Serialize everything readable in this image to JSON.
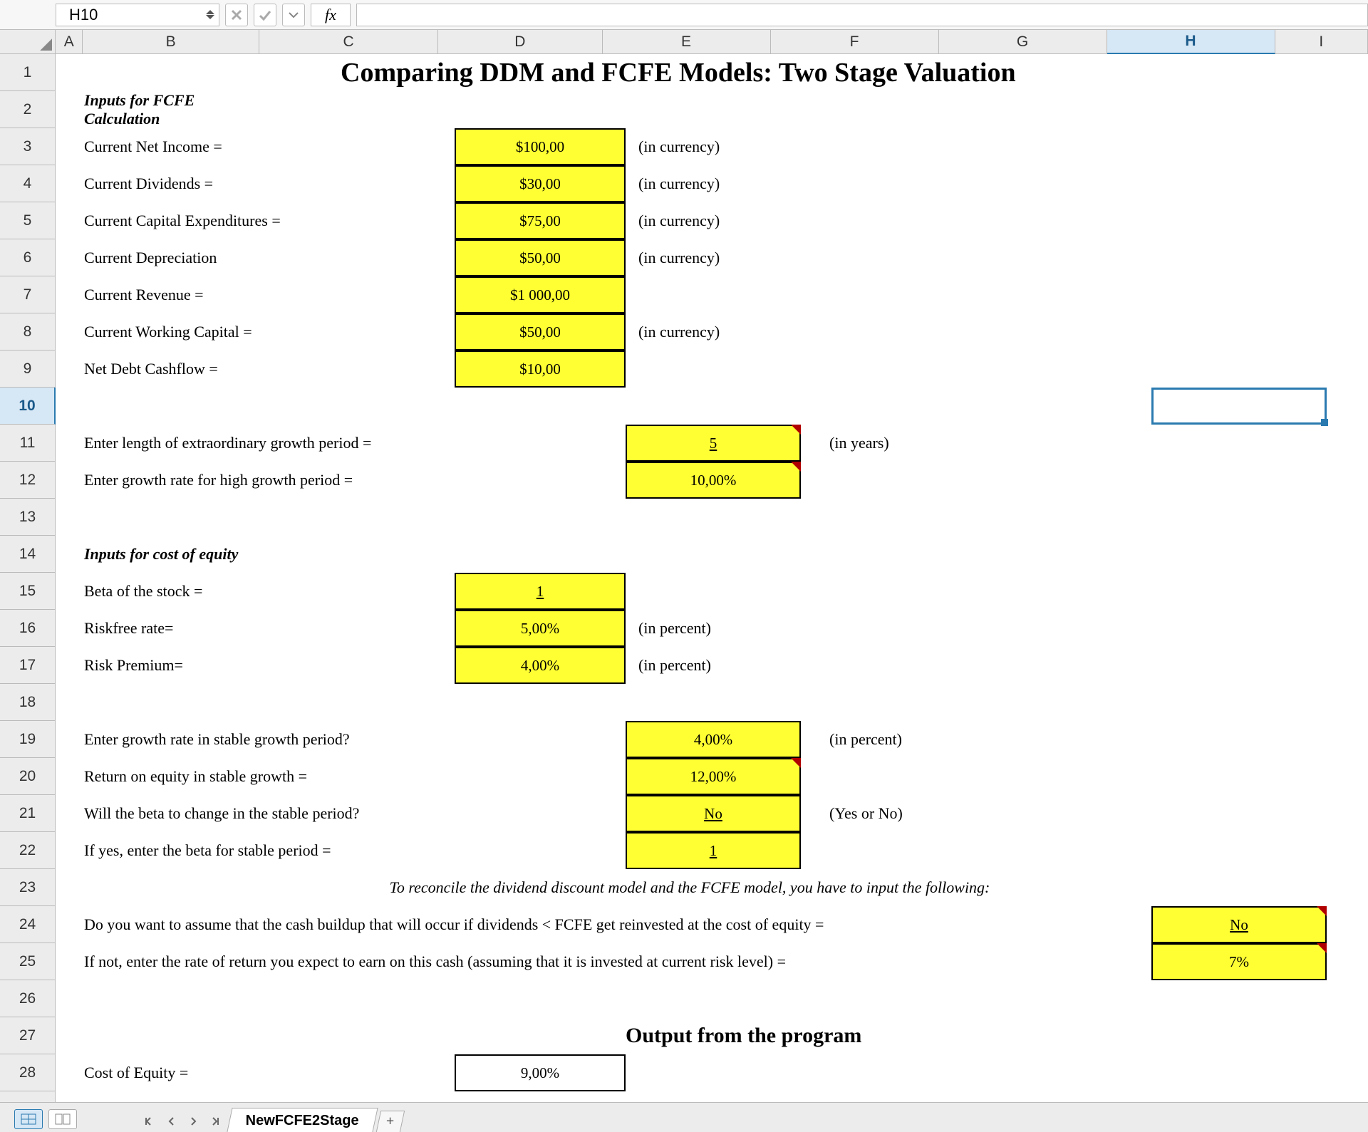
{
  "name_box": "H10",
  "columns": [
    "A",
    "B",
    "C",
    "D",
    "E",
    "F",
    "G",
    "H",
    "I"
  ],
  "selected_column": "H",
  "selected_row": 10,
  "rows_visible": 28,
  "title": "Comparing DDM and FCFE Models: Two Stage Valuation",
  "sections": {
    "fcfe_inputs_heading": "Inputs for FCFE Calculation",
    "coe_inputs_heading": "Inputs for cost of equity",
    "reconcile_note": "To reconcile the dividend discount model and the FCFE model, you have to input the following:",
    "output_heading": "Output from the program"
  },
  "labels": {
    "net_income": "Current Net Income =",
    "dividends": "Current Dividends =",
    "capex": "Current Capital Expenditures =",
    "depreciation": "Current Depreciation",
    "revenue": "Current Revenue =",
    "working_capital": "Current Working Capital =",
    "net_debt_cf": "Net Debt Cashflow =",
    "growth_length": "Enter length of extraordinary growth period =",
    "growth_rate_high": "Enter growth rate for high growth period =",
    "beta": "Beta of the stock =",
    "riskfree": "Riskfree rate=",
    "risk_premium": "Risk Premium=",
    "stable_growth": "Enter growth rate in stable growth period?",
    "roe_stable": "Return on equity in stable growth =",
    "beta_change_q": "Will the beta to change in the stable period?",
    "beta_stable": "If yes, enter the beta for stable period =",
    "assume_reinvest": "Do you want to assume that the cash buildup that will occur if dividends < FCFE get reinvested at the cost of equity =",
    "if_not_rate": "If not, enter the rate of return you expect to earn on this cash (assuming that it is invested at current risk level) =",
    "cost_of_equity": "Cost of Equity ="
  },
  "hints": {
    "in_currency": "(in currency)",
    "in_years": "(in years)",
    "in_percent": "(in percent)",
    "yes_or_no": "(Yes or No)"
  },
  "values": {
    "net_income": "$100,00",
    "dividends": "$30,00",
    "capex": "$75,00",
    "depreciation": "$50,00",
    "revenue": "$1 000,00",
    "working_capital": "$50,00",
    "net_debt_cf": "$10,00",
    "growth_length": "5",
    "growth_rate_high": "10,00%",
    "beta": "1",
    "riskfree": "5,00%",
    "risk_premium": "4,00%",
    "stable_growth": "4,00%",
    "roe_stable": "12,00%",
    "beta_change_q": "No",
    "beta_stable": "1",
    "assume_reinvest": "No",
    "if_not_rate": "7%",
    "cost_of_equity": "9,00%"
  },
  "sheet_tab": "NewFCFE2Stage"
}
